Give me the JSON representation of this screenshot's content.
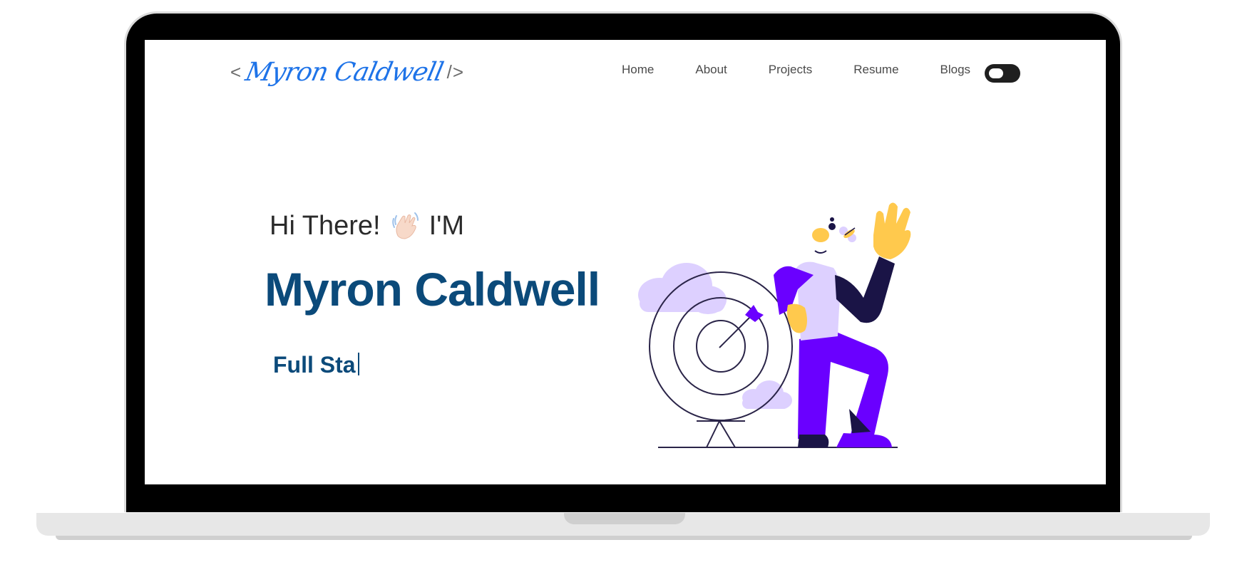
{
  "brand": {
    "open_bracket": "<",
    "name": "Myron Caldwell",
    "close_bracket": "/>"
  },
  "nav": {
    "items": [
      {
        "label": "Home"
      },
      {
        "label": "About"
      },
      {
        "label": "Projects"
      },
      {
        "label": "Resume"
      },
      {
        "label": "Blogs"
      }
    ],
    "theme_toggle": {
      "icon": "toggle-icon"
    }
  },
  "hero": {
    "greeting_prefix": "Hi There!",
    "greeting_suffix": "I'M",
    "wave_icon": "waving-hand-icon",
    "name": "Myron Caldwell",
    "typed_role": "Full Sta"
  },
  "illustration": {
    "icon": "person-with-target-illustration"
  },
  "colors": {
    "brand_blue": "#1e73e8",
    "name_navy": "#0b4a7a",
    "illustration_purple": "#6a00ff",
    "illustration_lavender": "#ddd0ff",
    "illustration_yellow": "#ffc94d",
    "illustration_dark": "#1a1446"
  }
}
